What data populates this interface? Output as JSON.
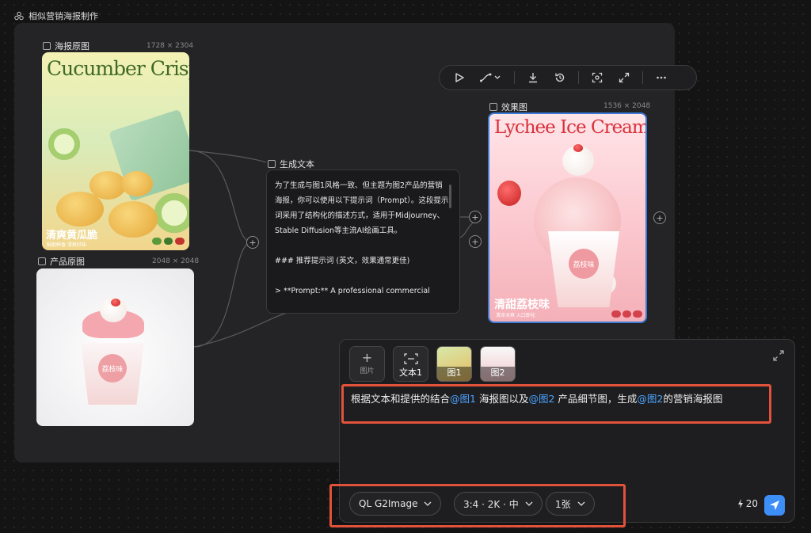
{
  "app": {
    "title": "相似营销海报制作"
  },
  "nodes": {
    "poster_original": {
      "label": "海报原图",
      "dims": "1728 × 2304",
      "title": "Cucumber Crisp",
      "subtitle": "清爽黄瓜脆",
      "tag_label": "酥脆鲜香 清爽好味"
    },
    "product_original": {
      "label": "产品原图",
      "dims": "2048 × 2048",
      "badge": "荔枝味"
    },
    "generated_text": {
      "label": "生成文本",
      "body": "为了生成与图1风格一致、但主题为图2产品的营销海报，你可以使用以下提示词（Prompt）。这段提示词采用了结构化的描述方式，适用于Midjourney、Stable Diffusion等主流AI绘画工具。\n\n### 推荐提示词 (英文，效果通常更佳)\n\n> **Prompt:** A professional commercial"
    },
    "effect": {
      "label": "效果图",
      "dims": "1536 × 2048",
      "title": "Lychee Ice Cream",
      "subtitle": "清甜荔枝味",
      "badge": "荔枝味",
      "tag_label": "清凉冰爽 入口即化"
    }
  },
  "toolbar": {
    "buttons": [
      "play-icon",
      "connect-icon",
      "download-icon",
      "history-icon",
      "scan-icon",
      "fullscreen-icon",
      "more-icon"
    ]
  },
  "chat": {
    "attachments": [
      {
        "label": "图片",
        "type": "add"
      },
      {
        "label": "文本1",
        "type": "text"
      },
      {
        "label": "图1",
        "type": "image"
      },
      {
        "label": "图2",
        "type": "image"
      }
    ],
    "prompt": {
      "part1": "根据文本和提供的结合",
      "mention1": "@图1",
      "part2": " 海报图以及",
      "mention2": "@图2",
      "part3": " 产品细节图，生成",
      "mention3": "@图2",
      "part4": "的营销海报图"
    },
    "model": "QL G2Image",
    "ratio": "3:4 · 2K · 中",
    "count": "1张",
    "credits": "20"
  },
  "colors": {
    "accent": "#3e8ef7",
    "mention": "#4ba3ff",
    "highlight_box": "#e2523a"
  }
}
